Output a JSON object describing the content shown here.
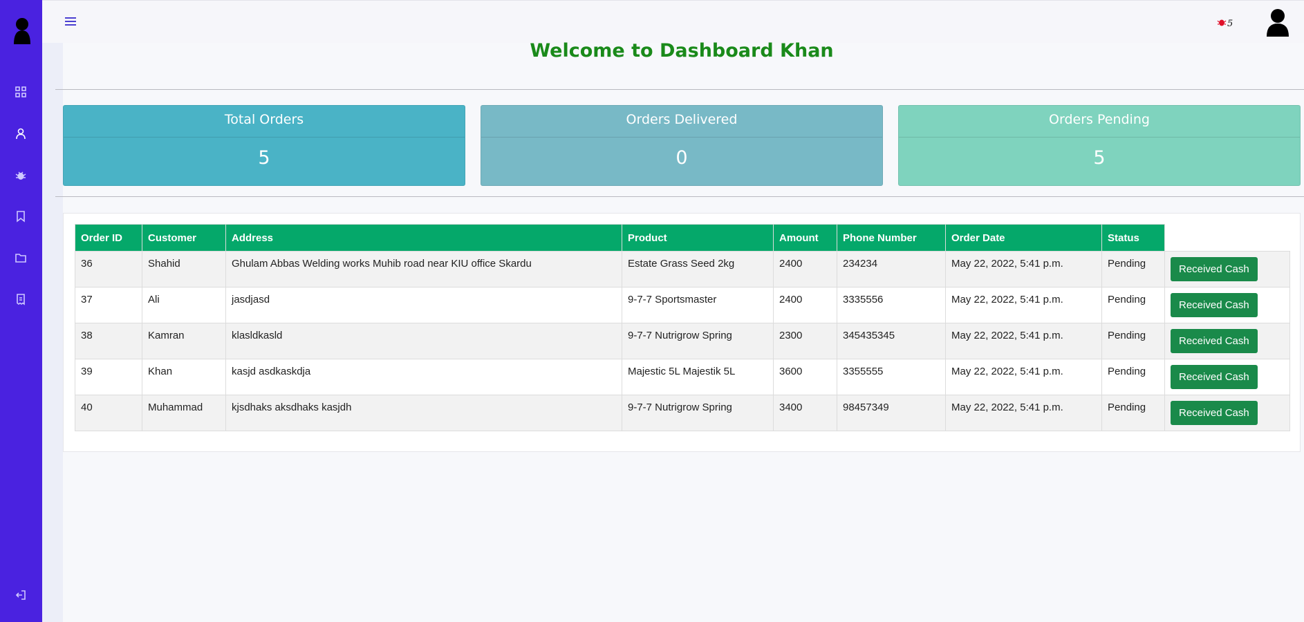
{
  "header": {
    "notification_count": "5"
  },
  "welcome_title": "Welcome to Dashboard Khan",
  "cards": [
    {
      "label": "Total Orders",
      "value": "5"
    },
    {
      "label": "Orders Delivered",
      "value": "0"
    },
    {
      "label": "Orders Pending",
      "value": "5"
    }
  ],
  "colors": {
    "sidebar": "#4a22e0",
    "card_total": "#4ab3c6",
    "card_delivered": "#78b9c6",
    "card_pending": "#7fd3be",
    "table_header": "#05a86a",
    "button": "#1a8a4a",
    "welcome": "#1a8a1a"
  },
  "sidebar": {
    "icons": [
      "grid-icon",
      "user-icon",
      "bug-icon",
      "bookmark-icon",
      "folder-icon",
      "receipt-icon",
      "logout-icon"
    ]
  },
  "table": {
    "columns": [
      "Order ID",
      "Customer",
      "Address",
      "Product",
      "Amount",
      "Phone Number",
      "Order Date",
      "Status"
    ],
    "action_label": "Received Cash",
    "rows": [
      {
        "id": "36",
        "customer": "Shahid",
        "address": "Ghulam Abbas Welding works Muhib road near KIU office Skardu",
        "product": "Estate Grass Seed 2kg",
        "amount": "2400",
        "phone": "234234",
        "date": "May 22, 2022, 5:41 p.m.",
        "status": "Pending"
      },
      {
        "id": "37",
        "customer": "Ali",
        "address": "jasdjasd",
        "product": "9-7-7 Sportsmaster",
        "amount": "2400",
        "phone": "3335556",
        "date": "May 22, 2022, 5:41 p.m.",
        "status": "Pending"
      },
      {
        "id": "38",
        "customer": "Kamran",
        "address": "klasldkasld",
        "product": "9-7-7 Nutrigrow Spring",
        "amount": "2300",
        "phone": "345435345",
        "date": "May 22, 2022, 5:41 p.m.",
        "status": "Pending"
      },
      {
        "id": "39",
        "customer": "Khan",
        "address": "kasjd asdkaskdja",
        "product": "Majestic 5L Majestik 5L",
        "amount": "3600",
        "phone": "3355555",
        "date": "May 22, 2022, 5:41 p.m.",
        "status": "Pending"
      },
      {
        "id": "40",
        "customer": "Muhammad",
        "address": "kjsdhaks aksdhaks kasjdh",
        "product": "9-7-7 Nutrigrow Spring",
        "amount": "3400",
        "phone": "98457349",
        "date": "May 22, 2022, 5:41 p.m.",
        "status": "Pending"
      }
    ]
  }
}
